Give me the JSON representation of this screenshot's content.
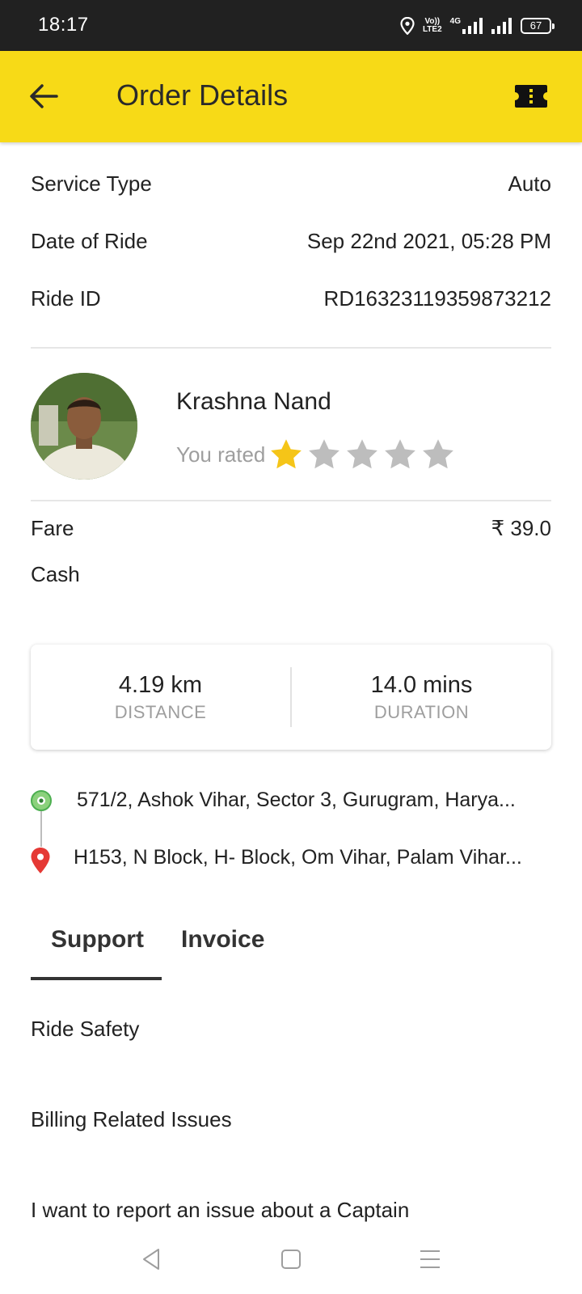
{
  "status_bar": {
    "time": "18:17",
    "network_label": "4G",
    "volte_label_top": "Vo))",
    "volte_label_bottom": "LTE2",
    "battery": "67"
  },
  "app_bar": {
    "title": "Order Details",
    "back_icon": "arrow-left-icon",
    "action_icon": "ticket-icon"
  },
  "details": {
    "service_type_label": "Service Type",
    "service_type_value": "Auto",
    "date_label": "Date of Ride",
    "date_value": "Sep 22nd 2021, 05:28 PM",
    "ride_id_label": "Ride ID",
    "ride_id_value": "RD16323119359873212"
  },
  "captain": {
    "name": "Krashna Nand",
    "rated_label": "You rated",
    "rating": 1,
    "max_rating": 5,
    "star_active_color": "#f5c518",
    "star_inactive_color": "#bdbdbd"
  },
  "payment": {
    "fare_label": "Fare",
    "fare_value": "₹ 39.0",
    "method": "Cash"
  },
  "trip_stats": {
    "distance_value": "4.19 km",
    "distance_label": "DISTANCE",
    "duration_value": "14.0 mins",
    "duration_label": "DURATION"
  },
  "locations": {
    "pickup": "571/2, Ashok Vihar, Sector 3, Gurugram, Harya...",
    "drop": "H153, N Block, H- Block, Om Vihar, Palam Vihar..."
  },
  "tabs": [
    {
      "label": "Support",
      "active": true
    },
    {
      "label": "Invoice",
      "active": false
    }
  ],
  "support_items": [
    "Ride Safety",
    "Billing Related Issues",
    "I want to report an issue about a Captain"
  ],
  "colors": {
    "app_bar": "#f7da17",
    "status_bar": "#212121",
    "pickup": "#4caf50",
    "drop": "#e53935"
  }
}
